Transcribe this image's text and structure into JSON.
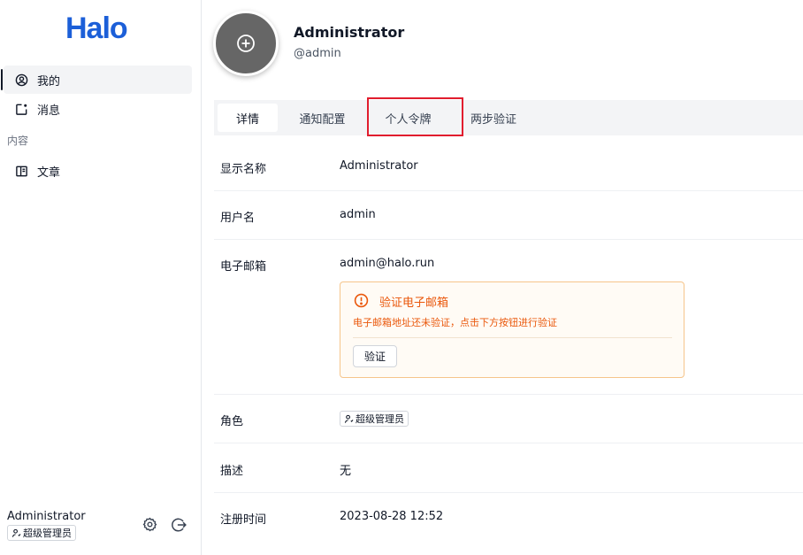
{
  "sidebar": {
    "logo": "Halo",
    "items": [
      {
        "label": "我的",
        "icon": "user-circle-icon"
      },
      {
        "label": "消息",
        "icon": "notification-icon"
      }
    ],
    "section": "内容",
    "content_items": [
      {
        "label": "文章",
        "icon": "book-icon"
      }
    ],
    "footer": {
      "name": "Administrator",
      "role": "超级管理员"
    }
  },
  "profile": {
    "name": "Administrator",
    "handle": "@admin"
  },
  "tabs": [
    {
      "label": "详情",
      "active": true
    },
    {
      "label": "通知配置",
      "active": false
    },
    {
      "label": "个人令牌",
      "active": false
    },
    {
      "label": "两步验证",
      "active": false
    }
  ],
  "details": {
    "display_name": {
      "label": "显示名称",
      "value": "Administrator"
    },
    "username": {
      "label": "用户名",
      "value": "admin"
    },
    "email": {
      "label": "电子邮箱",
      "value": "admin@halo.run"
    },
    "role": {
      "label": "角色",
      "value": "超级管理员"
    },
    "description": {
      "label": "描述",
      "value": "无"
    },
    "registered": {
      "label": "注册时间",
      "value": "2023-08-28 12:52"
    }
  },
  "email_alert": {
    "title": "验证电子邮箱",
    "description": "电子邮箱地址还未验证，点击下方按钮进行验证",
    "button": "验证"
  },
  "colors": {
    "brand": "#1c5fd8",
    "warning": "#ea580c",
    "highlight": "#e11d2e"
  }
}
